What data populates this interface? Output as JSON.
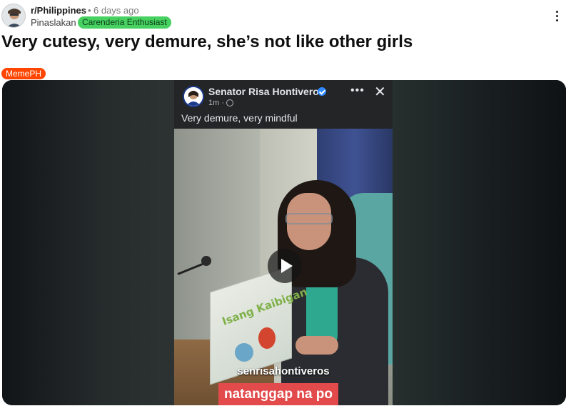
{
  "post": {
    "subreddit": "r/Philippines",
    "separator": "•",
    "time": "6 days ago",
    "author": "Pinaslakan",
    "user_flair": "Carenderia Enthusiast",
    "more_icon": "more-horizontal-icon",
    "title": "Very cutesy, very demure, she’s not like other girls",
    "post_flair": "MemePH",
    "flair_colors": {
      "user": "#46d160",
      "post": "#ff4500"
    }
  },
  "embed": {
    "page_name": "Senator Risa Hontiveros",
    "verified_icon": "verified-badge-icon",
    "time": "1m",
    "separator": "·",
    "privacy_icon": "globe-icon",
    "more_label": "•••",
    "close_label": "✕",
    "caption": "Very demure, very mindful",
    "book_title": "Isang Kaibigan",
    "play_icon": "play-icon",
    "watermark": "senrisahontiveros",
    "subtitle": "natanggap na po"
  }
}
